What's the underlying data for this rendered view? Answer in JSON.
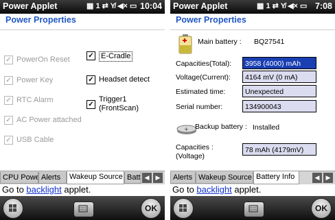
{
  "left": {
    "app_name": "Power Applet",
    "status_icons": "▦ 1 ⇄ Y̸ ◀× ▭",
    "clock": "10:04",
    "page_title": "Power Properties",
    "checkboxes": [
      {
        "label": "PowerOn Reset",
        "checked": true,
        "disabled": true
      },
      {
        "label": "Power Key",
        "checked": true,
        "disabled": true
      },
      {
        "label": "RTC Alarm",
        "checked": true,
        "disabled": true
      },
      {
        "label": "AC Power attached",
        "checked": true,
        "disabled": true
      },
      {
        "label": "USB Cable",
        "checked": true,
        "disabled": true
      },
      {
        "label": "E-Cradle",
        "checked": true,
        "disabled": false
      },
      {
        "label": "Headset detect",
        "checked": true,
        "disabled": false
      },
      {
        "label": "Trigger1 (FrontScan)",
        "checked": true,
        "disabled": false
      }
    ],
    "tabs": [
      "CPU Power",
      "Alerts",
      "Wakeup Source",
      "Batt"
    ],
    "active_tab": "Wakeup Source",
    "goto_prefix": "Go to ",
    "goto_link": "backlight",
    "goto_suffix": " applet.",
    "ok_label": "OK"
  },
  "right": {
    "app_name": "Power Applet",
    "status_icons": "▦ 1 ⇄ Y̸ ◀× ▭",
    "clock": "7:08",
    "page_title": "Power Properties",
    "main_battery_label": "Main battery :",
    "main_battery_model": "BQ27541",
    "fields": [
      {
        "label": "Capacities(Total):",
        "value": "3958 (4000) mAh",
        "selected": true
      },
      {
        "label": "Voltage(Current):",
        "value": "4164 mV (0 mA)",
        "selected": false
      },
      {
        "label": "Estimated time:",
        "value": "Unexpected",
        "selected": false
      },
      {
        "label": "Serial number:",
        "value": "134900043",
        "selected": false
      }
    ],
    "backup_battery_label": "Backup battery :",
    "backup_battery_status": "Installed",
    "backup_capacity_label": "Capacities : (Voltage)",
    "backup_capacity_value": "78 mAh (4179mV)",
    "tabs": [
      "Alerts",
      "Wakeup Source",
      "Battery Info"
    ],
    "active_tab": "Battery Info",
    "goto_prefix": "Go to ",
    "goto_link": "backlight",
    "goto_suffix": " applet.",
    "ok_label": "OK"
  },
  "colors": {
    "title_blue": "#1f57c4",
    "selection": "#1a3fb3",
    "field_bg": "#dcdcf0",
    "link": "#1030d0"
  },
  "icons": [
    "windows-start-icon",
    "keyboard-icon",
    "battery-icon",
    "coin-battery-icon",
    "tab-left-arrow-icon",
    "tab-right-arrow-icon"
  ]
}
